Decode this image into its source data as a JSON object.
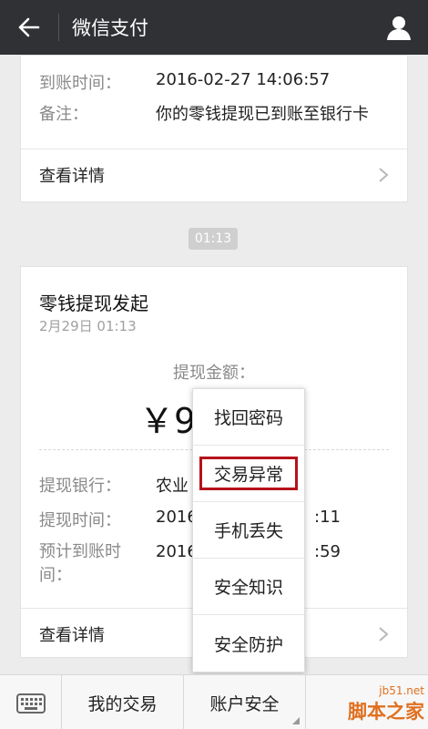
{
  "header": {
    "title": "微信支付"
  },
  "card1": {
    "rows": [
      {
        "label": "到账时间：",
        "value": "2016-02-27 14:06:57"
      },
      {
        "label": "备注：",
        "value": "你的零钱提现已到账至银行卡"
      }
    ],
    "detail_label": "查看详情"
  },
  "time_pill": "01:13",
  "card2": {
    "title": "零钱提现发起",
    "date": "2月29日 01:13",
    "amount_label": "提现金额：",
    "amount_value": "￥9",
    "rows": [
      {
        "label": "提现银行：",
        "value": "农业"
      },
      {
        "label": "提现时间：",
        "value": "2016",
        "tail": ":11"
      },
      {
        "label": "预计到账时",
        "label2": "间：",
        "value": "2016",
        "tail": ":59"
      }
    ],
    "detail_label": "查看详情"
  },
  "popup": {
    "items": [
      "找回密码",
      "交易异常",
      "手机丢失",
      "安全知识",
      "安全防护"
    ],
    "highlighted_index": 1
  },
  "bottombar": {
    "tabs": [
      "我的交易",
      "账户安全"
    ]
  },
  "watermark": {
    "url": "jb51.net",
    "text": "脚本之家"
  },
  "colors": {
    "header_bg": "#2f3134",
    "highlight": "#b5121b",
    "watermark": "#e07020"
  }
}
